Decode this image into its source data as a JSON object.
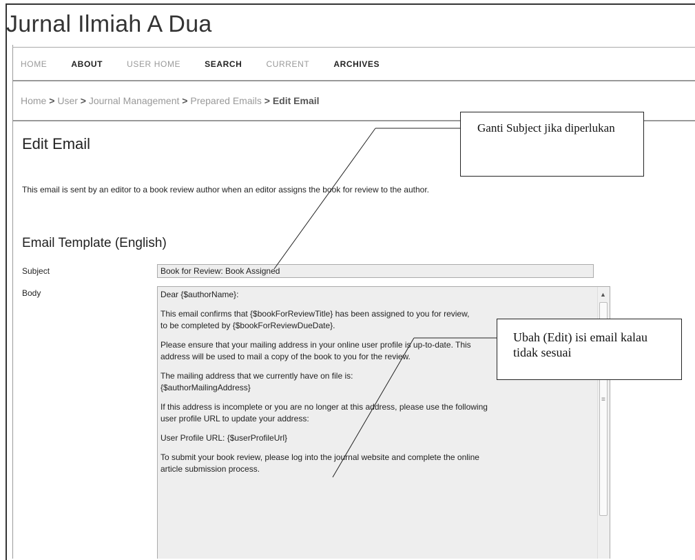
{
  "site_title": "Jurnal Ilmiah A Dua",
  "nav": [
    {
      "label": "HOME",
      "style": "dim"
    },
    {
      "label": "ABOUT",
      "style": "bold"
    },
    {
      "label": "USER HOME",
      "style": "dim"
    },
    {
      "label": "SEARCH",
      "style": "bold"
    },
    {
      "label": "CURRENT",
      "style": "dim"
    },
    {
      "label": "ARCHIVES",
      "style": "bold"
    }
  ],
  "breadcrumb": {
    "items": [
      "Home",
      "User",
      "Journal Management",
      "Prepared Emails"
    ],
    "current": "Edit Email",
    "separator": ">"
  },
  "page_heading": "Edit Email",
  "description": "This email is sent by an editor to a book review author when an editor assigns the book for review to the author.",
  "template_heading": "Email Template (English)",
  "subject": {
    "label": "Subject",
    "value": "Book for Review: Book Assigned"
  },
  "body": {
    "label": "Body",
    "paragraphs": [
      "Dear {$authorName}:",
      "This email confirms that {$bookForReviewTitle} has been assigned to you for review,\nto be completed by {$bookForReviewDueDate}.",
      "Please ensure that your mailing address in your online user profile is up-to-date. This\naddress will be used to mail a copy of the book to you for the review.",
      "The mailing address that we currently have on file is:\n{$authorMailingAddress}",
      "If this address is incomplete or you are no longer at this address, please use the following\nuser profile URL to update your address:",
      "User Profile URL: {$userProfileUrl}",
      "To submit your book review, please log into the journal website and complete the online\narticle submission process."
    ]
  },
  "callouts": {
    "subject_note": "Ganti Subject jika diperlukan",
    "body_note": "Ubah (Edit) isi email kalau tidak sesuai"
  }
}
